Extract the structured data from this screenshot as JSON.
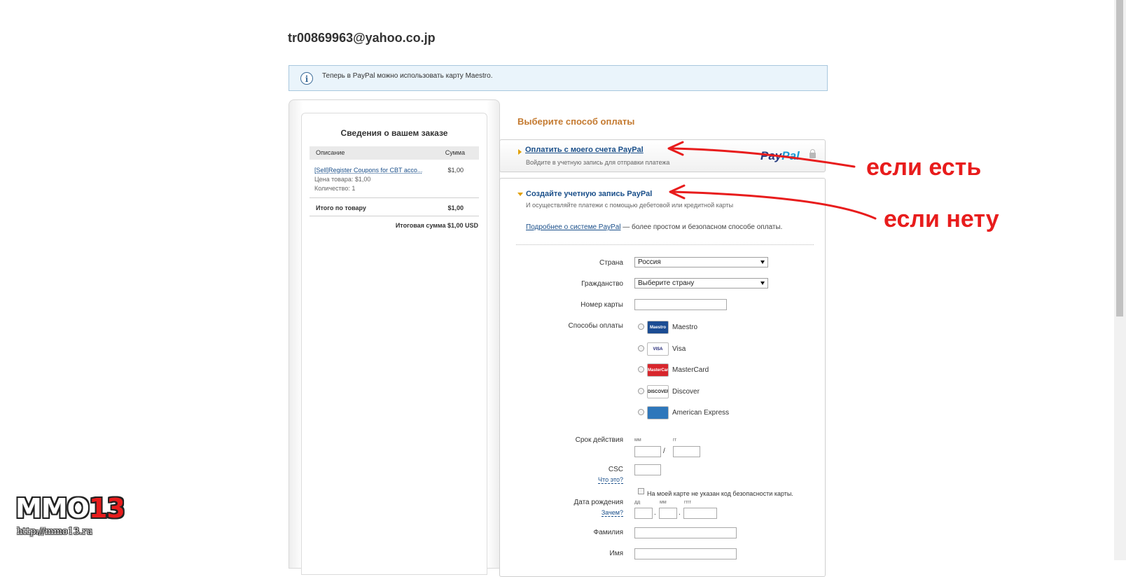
{
  "account_email": "tr00869963@yahoo.co.jp",
  "notice": {
    "message": "Теперь в PayPal можно использовать карту Maestro."
  },
  "order": {
    "title": "Сведения о вашем заказе",
    "col_description": "Описание",
    "col_amount": "Сумма",
    "item_name": "[Sell]Register Coupons for CBT acco...",
    "item_price": "$1,00",
    "item_unit_price": "Цена товара: $1,00",
    "item_quantity": "Количество: 1",
    "subtotal_label": "Итого по товару",
    "subtotal_value": "$1,00",
    "total": "Итоговая сумма $1,00 USD"
  },
  "payment": {
    "choose_title": "Выберите способ оплаты",
    "option1_title": "Оплатить с моего счета PayPal",
    "option1_subtitle": "Войдите в учетную запись для отправки платежа",
    "paypal_logo_part1": "Pay",
    "paypal_logo_part2": "Pal",
    "option2_title": "Создайте учетную запись PayPal",
    "option2_subtitle": "И осуществляйте платежи с помощью дебетовой или кредитной карты",
    "learn_more_link": "Подробнее о системе PayPal",
    "learn_more_text": " — более простом и безопасном способе оплаты."
  },
  "form": {
    "country_label": "Страна",
    "country_value": "Россия",
    "citizenship_label": "Гражданство",
    "citizenship_value": "Выберите страну",
    "card_number_label": "Номер карты",
    "payment_methods_label": "Способы оплаты",
    "cards": [
      {
        "name": "Maestro",
        "icon": "maestro-logo",
        "icon_text": "Maestro",
        "bg": "#1b4c93",
        "fg": "#ffffff"
      },
      {
        "name": "Visa",
        "icon": "visa-logo",
        "icon_text": "VISA",
        "bg": "#ffffff",
        "fg": "#1a1f71"
      },
      {
        "name": "MasterCard",
        "icon": "mastercard-logo",
        "icon_text": "MasterCard",
        "bg": "#d8262c",
        "fg": "#ffffff"
      },
      {
        "name": "Discover",
        "icon": "discover-logo",
        "icon_text": "DISCOVER",
        "bg": "#ffffff",
        "fg": "#222222"
      },
      {
        "name": "American Express",
        "icon": "amex-logo",
        "icon_text": "",
        "bg": "#2e77bb",
        "fg": "#ffffff"
      }
    ],
    "expiry_label": "Срок действия",
    "expiry_month_hint": "мм",
    "expiry_year_hint": "гг",
    "expiry_separator": "/",
    "csc_label": "CSC",
    "csc_help_link": "Что это?",
    "no_csc_label": "На моей карте не указан код безопасности карты.",
    "dob_label": "Дата рождения",
    "dob_help_link": "Зачем?",
    "dob_day_hint": "дд",
    "dob_month_hint": "мм",
    "dob_year_hint": "гггг",
    "dob_separator": ".",
    "last_name_label": "Фамилия",
    "first_name_label": "Имя"
  },
  "annotations": {
    "has_account": "если есть",
    "no_account": "если нету",
    "color": "#e81c1c"
  },
  "watermark": {
    "logo_text": "MMO",
    "logo_number": "13",
    "url": "http://mmo13.ru"
  }
}
